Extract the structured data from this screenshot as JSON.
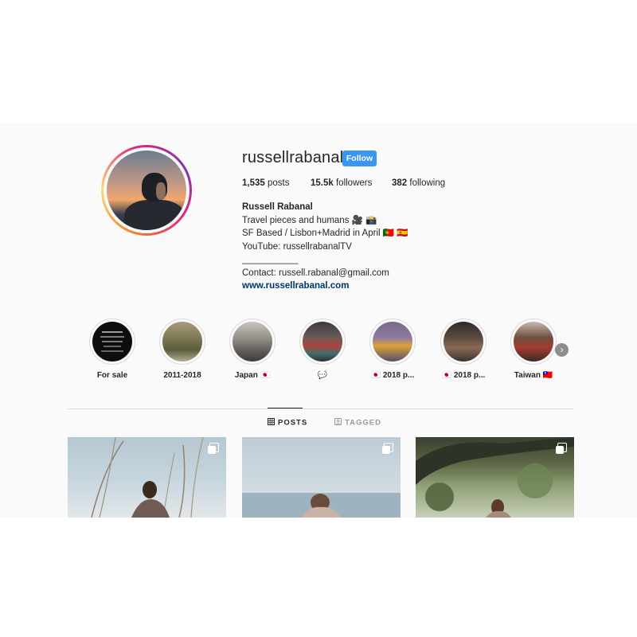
{
  "profile": {
    "username": "russellrabanal",
    "follow_label": "Follow",
    "stats": {
      "posts_count": "1,535",
      "posts_label": "posts",
      "followers_count": "15.5k",
      "followers_label": "followers",
      "following_count": "382",
      "following_label": "following"
    },
    "bio": {
      "name": "Russell Rabanal",
      "line1": "Travel pieces and humans 🎥 📸",
      "line2": "SF Based / Lisbon+Madrid in April 🇵🇹 🇪🇸",
      "line3": "YouTube: russellrabanalTV",
      "separator": "___________",
      "contact": "Contact: russell.rabanal@gmail.com",
      "website": "www.russellrabanal.com"
    }
  },
  "highlights": [
    {
      "label": "For sale"
    },
    {
      "label": "2011-2018"
    },
    {
      "label": "Japan 🇯🇵"
    },
    {
      "label": "💬"
    },
    {
      "label": "🇯🇵 2018 p..."
    },
    {
      "label": "🇯🇵 2018 p..."
    },
    {
      "label": "Taiwan 🇹🇼"
    }
  ],
  "tabs": {
    "posts_label": "POSTS",
    "tagged_label": "TAGGED"
  },
  "colors": {
    "follow_button": "#3897f0",
    "link": "#003569",
    "panel_background": "#fafafa"
  },
  "icons": {
    "highlights_next": "chevron-right-icon",
    "posts_tab": "grid-icon",
    "tagged_tab": "tag-icon",
    "multi_post": "carousel-icon"
  }
}
